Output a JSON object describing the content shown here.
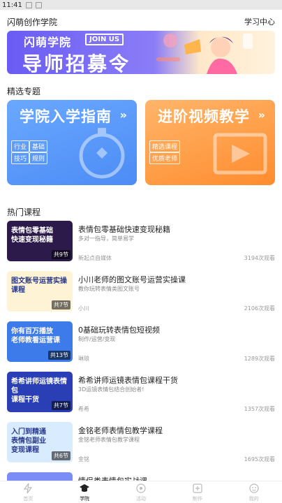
{
  "status": {
    "time": "11:41"
  },
  "header": {
    "title": "闪萌创作学院",
    "link": "学习中心"
  },
  "banner": {
    "line1": "闪萌学院",
    "badge": "JOIN US",
    "line2": "导师招募令"
  },
  "featured": {
    "title": "精选专题",
    "cards": [
      {
        "title": "学院入学指南",
        "arrow": "»",
        "tags": [
          "行业",
          "基础",
          "技巧",
          "规则"
        ]
      },
      {
        "title": "进阶视频教学",
        "arrow": "»",
        "tags": [
          "精选课程",
          "优质老师"
        ]
      }
    ]
  },
  "hot": {
    "title": "热门课程",
    "courses": [
      {
        "thumb_text": "表情包零基础\n快速变现秘籍",
        "badge": "共9节",
        "title": "表情包零基础快速变现秘籍",
        "desc": "多对一指导，简单易学",
        "author": "新起点自媒体",
        "views": "3194次观看",
        "bg": "#2b1a4a"
      },
      {
        "thumb_text": "图文账号运营实操课程",
        "badge": "共7节",
        "title": "小川老师的图文账号运营实操课",
        "desc": "教你玩转表情类图文账号",
        "author": "小川",
        "views": "2106次观看",
        "bg": "#fff3d6"
      },
      {
        "thumb_text": "你有百万播放\n老师教看运营课",
        "badge": "共13节",
        "title": "0基础玩转表情包短视频",
        "desc": "制作/运营/变现",
        "author": "琳琅",
        "views": "1289次观看",
        "bg": "#3d7bea"
      },
      {
        "thumb_text": "希希讲师运镜表情包\n课程干货",
        "badge": "共7节",
        "title": "希希讲师运镜表情包课程干货",
        "desc": "3D运镜表情包结合创始者!",
        "author": "希希",
        "views": "1357次观看",
        "bg": "#2a3eb5"
      },
      {
        "thumb_text": "入门到精通\n表情包副业\n变现课程",
        "badge": "共6节",
        "title": "金铭老师表情包教学课程",
        "desc": "金铭老师表情包教学课程",
        "author": "金铭",
        "views": "1695次观看",
        "bg": "#d9ecff"
      },
      {
        "thumb_text": "",
        "badge": "",
        "title": "情侣类表情包实战课",
        "desc": "",
        "author": "",
        "views": "",
        "bg": "#7b8cf7"
      }
    ]
  },
  "tabs": [
    {
      "label": "首页",
      "icon": "flash-icon"
    },
    {
      "label": "学院",
      "icon": "graduation-cap-icon",
      "active": true
    },
    {
      "label": "活动",
      "icon": "activity-icon"
    },
    {
      "label": "制作",
      "icon": "create-icon"
    },
    {
      "label": "我的",
      "icon": "user-icon"
    }
  ]
}
